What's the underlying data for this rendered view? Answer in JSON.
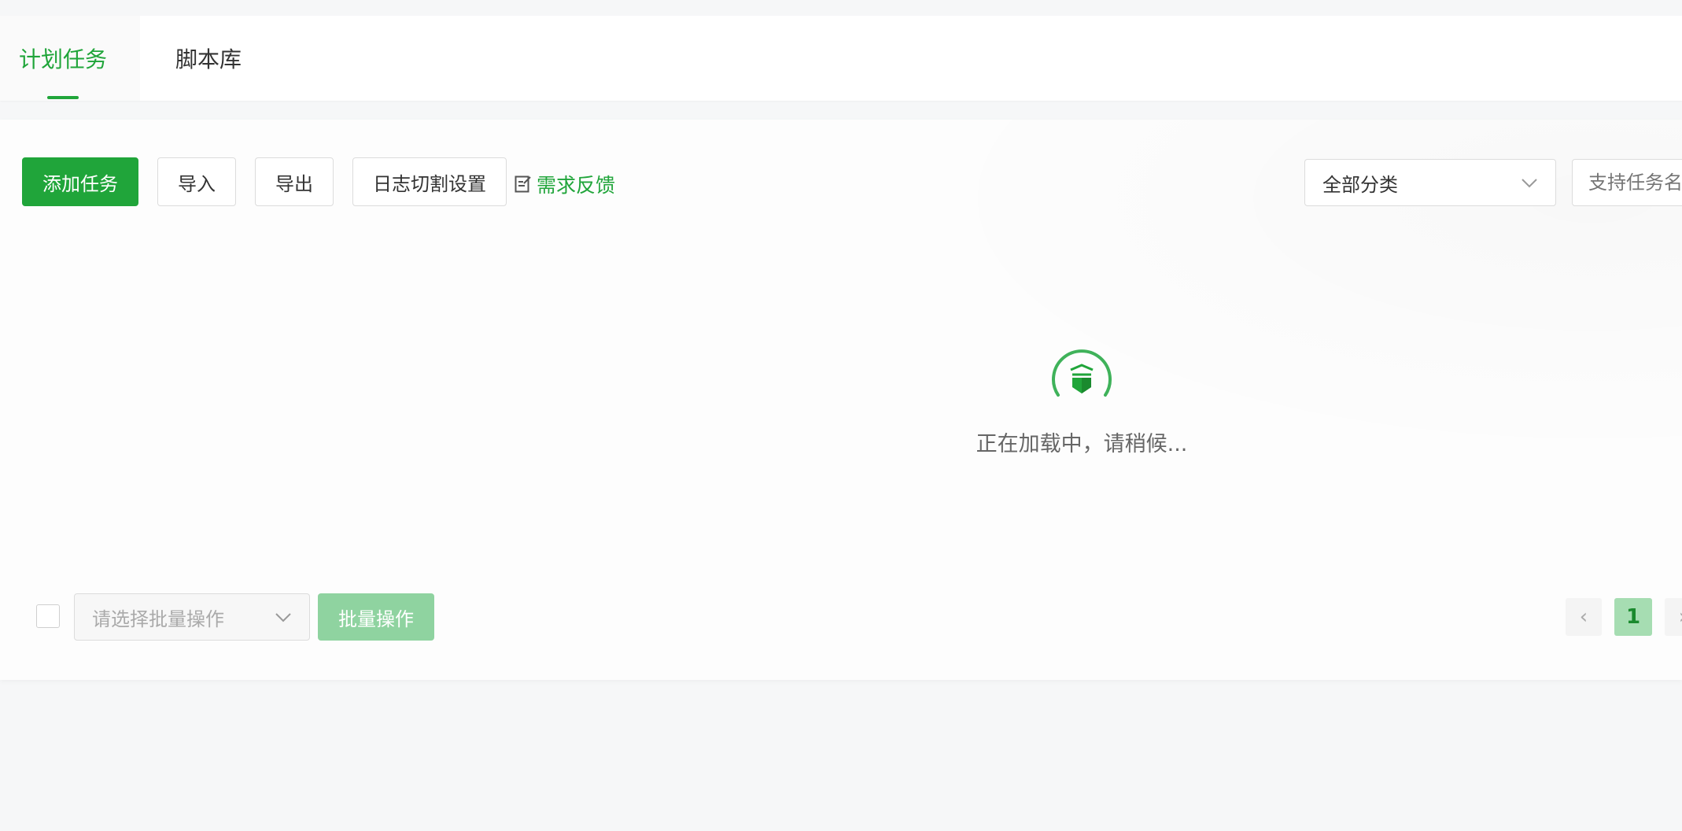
{
  "tabs": [
    {
      "label": "计划任务",
      "active": true
    },
    {
      "label": "脚本库",
      "active": false
    }
  ],
  "toolbar": {
    "add_task": "添加任务",
    "import": "导入",
    "export": "导出",
    "log_split": "日志切割设置",
    "feedback": "需求反馈"
  },
  "filters": {
    "category_selected": "全部分类",
    "search_placeholder": "支持任务名称"
  },
  "loading": {
    "text": "正在加载中，请稍候..."
  },
  "batch": {
    "select_placeholder": "请选择批量操作",
    "button": "批量操作"
  },
  "pagination": {
    "current": "1"
  },
  "colors": {
    "primary": "#20a53a",
    "primary_light": "#8fd3a0"
  },
  "icons": {
    "feedback": "edit-note-icon",
    "loading": "bt-logo-spinner-icon",
    "dropdown": "chevron-down-icon",
    "prev": "chevron-left-icon",
    "next": "chevron-right-icon"
  }
}
